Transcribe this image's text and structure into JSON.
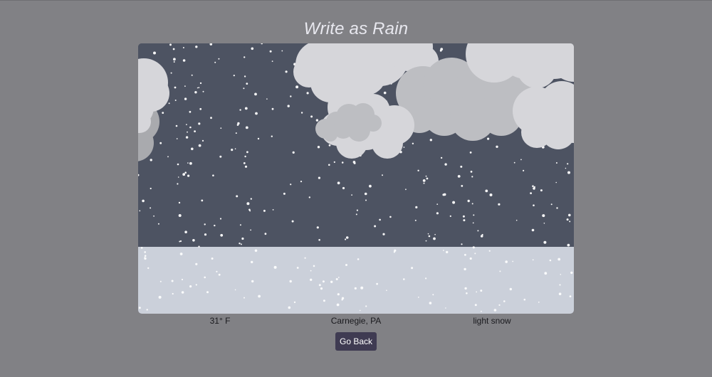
{
  "app": {
    "title": "Write as Rain"
  },
  "weather": {
    "temperature": "31° F",
    "location": "Carnegie, PA",
    "condition": "light snow"
  },
  "actions": {
    "back_label": "Go Back"
  },
  "scene": {
    "sky_color": "#4d5362",
    "ground_color": "#cbd0da",
    "cloud_light": "#d6d6da",
    "cloud_mid": "#bdbec2",
    "cloud_dark": "#a9aaae",
    "snow_color": "#ffffff"
  },
  "colors": {
    "page_background": "#818185",
    "title_text": "#e8e8ef",
    "button_background": "#3f3b52"
  },
  "icons": {
    "clouds": "cloud-shapes",
    "snowflakes": "snowflake-dots"
  }
}
